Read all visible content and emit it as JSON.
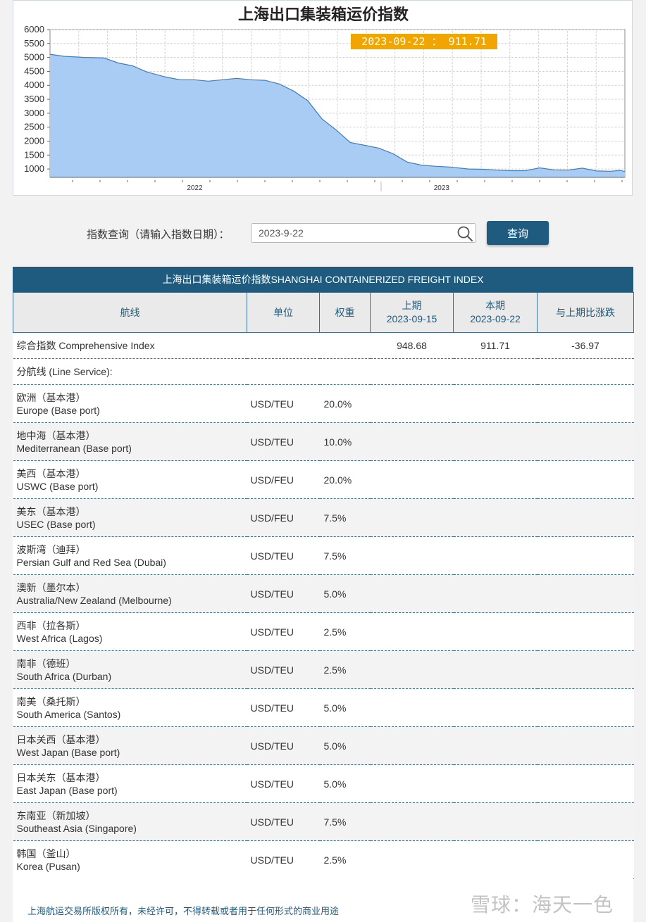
{
  "chart_data": {
    "type": "area",
    "title": "上海出口集装箱运价指数",
    "yticks": [
      1000,
      1500,
      2000,
      2500,
      3000,
      3500,
      4000,
      4500,
      5000,
      5500,
      6000
    ],
    "ylim": [
      700,
      6000
    ],
    "xlim": [
      "2021-06-01",
      "2023-09-29"
    ],
    "xticks": [
      {
        "date": "2022-01-01",
        "label": "2022"
      },
      {
        "date": "2023-01-01",
        "label": "2023"
      }
    ],
    "tooltip": {
      "date": "2023-09-22",
      "value": "911.71",
      "text": "2023-09-22 ： 911.71"
    },
    "grid": true,
    "fill_color": "#a8ccf4",
    "line_color": "#3a7fc2",
    "series": [
      {
        "x": [
          "2021-06-01",
          "2021-06-22",
          "2021-07-23",
          "2021-08-20",
          "2021-09-10",
          "2021-10-01",
          "2021-10-22",
          "2021-11-19",
          "2021-12-10",
          "2021-12-31",
          "2022-01-21",
          "2022-02-11",
          "2022-03-04",
          "2022-03-25",
          "2022-04-15",
          "2022-05-06",
          "2022-05-27",
          "2022-06-17",
          "2022-07-08",
          "2022-07-29",
          "2022-08-19",
          "2022-09-09",
          "2022-09-30",
          "2022-10-21",
          "2022-11-11",
          "2022-12-02",
          "2022-12-23",
          "2023-01-13",
          "2023-02-10",
          "2023-03-03",
          "2023-03-24",
          "2023-04-14",
          "2023-05-05",
          "2023-05-26",
          "2023-06-16",
          "2023-07-07",
          "2023-07-28",
          "2023-08-18",
          "2023-09-08",
          "2023-09-22"
        ],
        "y": [
          5115,
          5040,
          5000,
          4980,
          4800,
          4700,
          4480,
          4300,
          4200,
          4200,
          4150,
          4200,
          4250,
          4200,
          4180,
          4050,
          3800,
          3450,
          2800,
          2400,
          1950,
          1850,
          1750,
          1550,
          1250,
          1140,
          1100,
          1070,
          1000,
          990,
          960,
          940,
          940,
          1040,
          970,
          960,
          1030,
          930,
          920,
          948.68
        ]
      }
    ]
  },
  "query": {
    "label": "指数查询（请输入指数日期）：",
    "date_value": "2023-9-22",
    "button_label": "查询"
  },
  "table": {
    "banner": "上海出口集装箱运价指数SHANGHAI CONTAINERIZED FREIGHT INDEX",
    "headers": {
      "route": "航线",
      "unit": "单位",
      "weight": "权重",
      "prev_label": "上期",
      "prev_date": "2023-09-15",
      "curr_label": "本期",
      "curr_date": "2023-09-22",
      "change": "与上期比涨跌"
    },
    "summary": {
      "name": "综合指数 Comprehensive Index",
      "prev": "948.68",
      "curr": "911.71",
      "change": "-36.97"
    },
    "section_label": "分航线 (Line Service):",
    "rows": [
      {
        "cn": "欧洲（基本港）",
        "en": "Europe (Base port)",
        "unit": "USD/TEU",
        "weight": "20.0%"
      },
      {
        "cn": "地中海（基本港）",
        "en": "Mediterranean (Base port)",
        "unit": "USD/TEU",
        "weight": "10.0%"
      },
      {
        "cn": "美西（基本港）",
        "en": "USWC (Base port)",
        "unit": "USD/FEU",
        "weight": "20.0%"
      },
      {
        "cn": "美东（基本港）",
        "en": "USEC (Base port)",
        "unit": "USD/FEU",
        "weight": "7.5%"
      },
      {
        "cn": "波斯湾（迪拜）",
        "en": "Persian Gulf and Red Sea (Dubai)",
        "unit": "USD/TEU",
        "weight": "7.5%"
      },
      {
        "cn": "澳新（墨尔本）",
        "en": "Australia/New Zealand (Melbourne)",
        "unit": "USD/TEU",
        "weight": "5.0%"
      },
      {
        "cn": "西非（拉各斯）",
        "en": "West Africa (Lagos)",
        "unit": "USD/TEU",
        "weight": "2.5%"
      },
      {
        "cn": "南非（德班）",
        "en": "South Africa (Durban)",
        "unit": "USD/TEU",
        "weight": "2.5%"
      },
      {
        "cn": "南美（桑托斯）",
        "en": "South America (Santos)",
        "unit": "USD/TEU",
        "weight": "5.0%"
      },
      {
        "cn": "日本关西（基本港）",
        "en": "West Japan (Base port)",
        "unit": "USD/TEU",
        "weight": "5.0%"
      },
      {
        "cn": "日本关东（基本港）",
        "en": "East Japan (Base port)",
        "unit": "USD/TEU",
        "weight": "5.0%"
      },
      {
        "cn": "东南亚（新加坡）",
        "en": "Southeast Asia (Singapore)",
        "unit": "USD/TEU",
        "weight": "7.5%"
      },
      {
        "cn": "韩国（釜山）",
        "en": "Korea (Pusan)",
        "unit": "USD/TEU",
        "weight": "2.5%"
      }
    ]
  },
  "footer": {
    "copyright": "上海航运交易所版权所有，未经许可，不得转载或者用于任何形式的商业用途",
    "watermark": "雪球：海天一色"
  }
}
